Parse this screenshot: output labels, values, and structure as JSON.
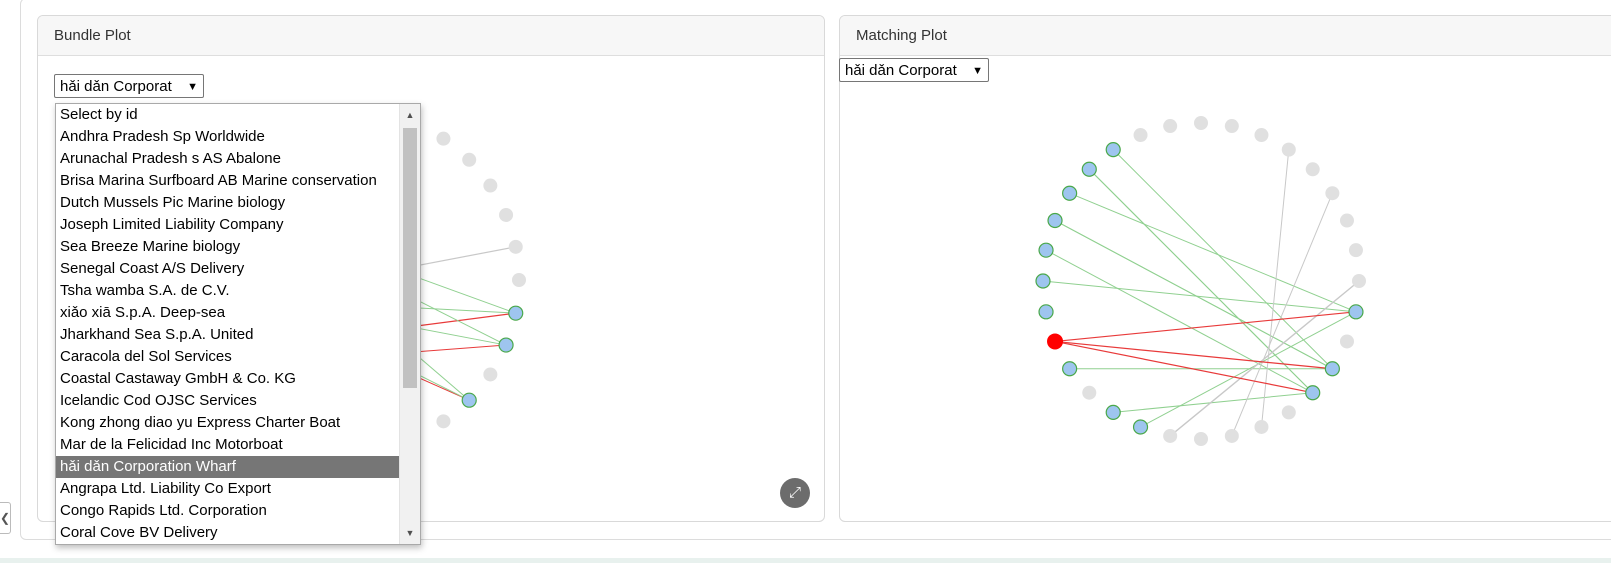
{
  "bundle": {
    "title": "Bundle Plot",
    "select_value": "hǎi dǎn Corporat",
    "options": [
      "Select by id",
      "Andhra Pradesh Sp Worldwide",
      "Arunachal Pradesh s AS Abalone",
      "Brisa Marina Surfboard AB Marine conservation",
      "Dutch Mussels Pic Marine biology",
      "Joseph Limited Liability Company",
      "Sea Breeze Marine biology",
      "Senegal Coast A/S Delivery",
      "Tsha wamba S.A. de C.V.",
      "xiǎo xiā S.p.A. Deep-sea",
      "Jharkhand Sea S.p.A. United",
      "Caracola del Sol Services",
      "Coastal Castaway GmbH & Co. KG",
      "Icelandic Cod OJSC Services",
      "Kong zhong diao yu Express Charter Boat",
      "Mar de la Felicidad Inc Motorboat",
      "hǎi dǎn Corporation Wharf",
      "Angrapa Ltd. Liability Co Export",
      "Congo Rapids Ltd. Corporation",
      "Coral Cove BV Delivery"
    ],
    "selected_option": "hǎi dǎn Corporation Wharf"
  },
  "matching": {
    "title": "Matching Plot",
    "select_value": "hǎi dǎn Corporat"
  },
  "icons": {
    "chevron": "chevron-down-icon",
    "fullscreen": "expand-icon",
    "collapse": "chevron-left-icon"
  },
  "colors": {
    "node_blue": "#9ec5ef",
    "node_grey": "#e0e0e0",
    "node_red": "#ff0000",
    "edge_green": "#90d090",
    "edge_red": "#e83a3a",
    "edge_grey": "#c8c8c8"
  }
}
